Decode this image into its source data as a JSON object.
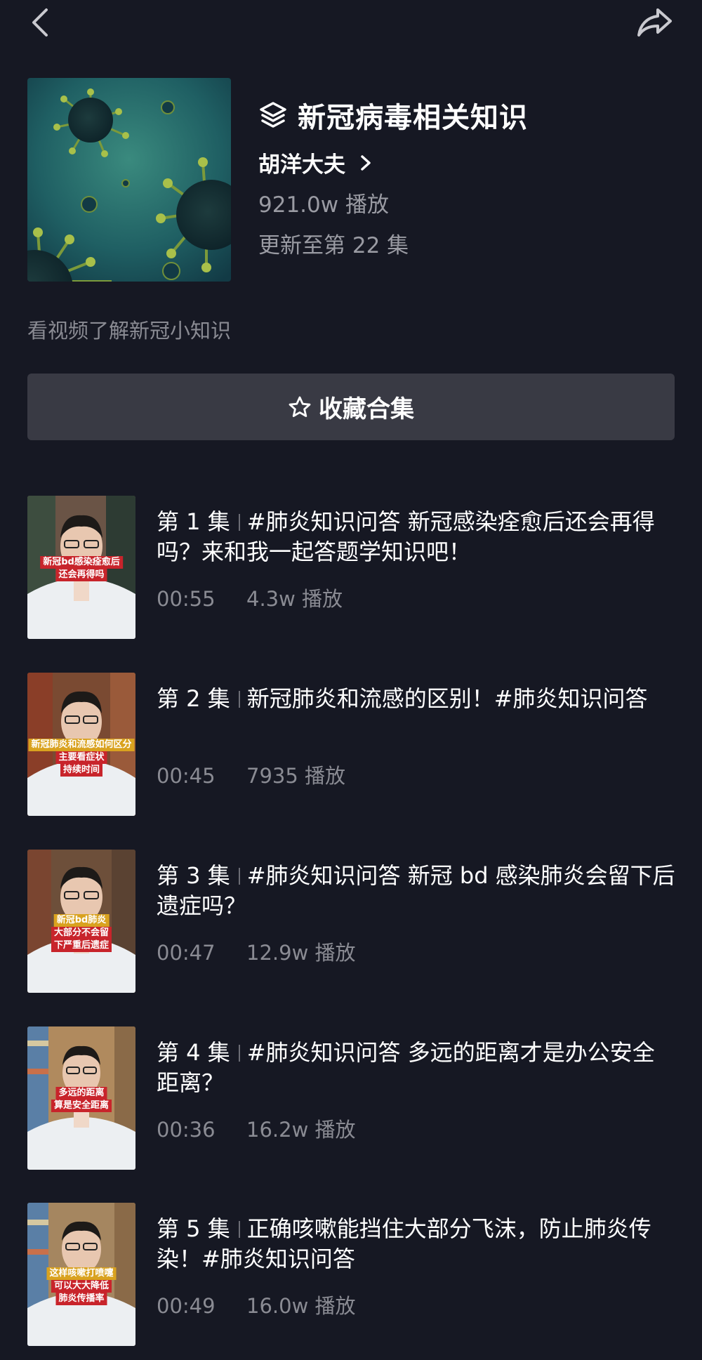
{
  "nav": {
    "back_icon": "chevron-left-icon",
    "share_icon": "share-arrow-icon"
  },
  "collection": {
    "title": "新冠病毒相关知识",
    "title_icon": "layers-icon",
    "author": "胡洋大夫",
    "plays": "921.0w 播放",
    "update": "更新至第 22 集",
    "description": "看视频了解新冠小知识",
    "collect_label": "收藏合集",
    "collect_icon": "star-outline-icon"
  },
  "episodes": [
    {
      "number": "第 1 集",
      "title": "#肺炎知识问答 新冠感染痊愈后还会再得吗？来和我一起答题学知识吧！",
      "duration": "00:55",
      "plays": "4.3w 播放",
      "thumb_caption": [
        "新冠bd感染痊愈后",
        "还会再得吗"
      ]
    },
    {
      "number": "第 2 集",
      "title": "新冠肺炎和流感的区别！#肺炎知识问答",
      "duration": "00:45",
      "plays": "7935 播放",
      "thumb_caption": [
        "新冠肺炎和流感如何区分",
        "主要看症状",
        "持续时间"
      ]
    },
    {
      "number": "第 3 集",
      "title": "#肺炎知识问答 新冠 bd 感染肺炎会留下后遗症吗？",
      "duration": "00:47",
      "plays": "12.9w 播放",
      "thumb_caption": [
        "新冠bd肺炎",
        "大部分不会留",
        "下严重后遗症"
      ]
    },
    {
      "number": "第 4 集",
      "title": "#肺炎知识问答 多远的距离才是办公安全距离？",
      "duration": "00:36",
      "plays": "16.2w 播放",
      "thumb_caption": [
        "多远的距离",
        "算是安全距离"
      ]
    },
    {
      "number": "第 5 集",
      "title": "正确咳嗽能挡住大部分飞沫，防止肺炎传染！#肺炎知识问答",
      "duration": "00:49",
      "plays": "16.0w 播放",
      "thumb_caption": [
        "这样咳嗽打喷嚏",
        "可以大大降低",
        "肺炎传播率"
      ]
    }
  ]
}
